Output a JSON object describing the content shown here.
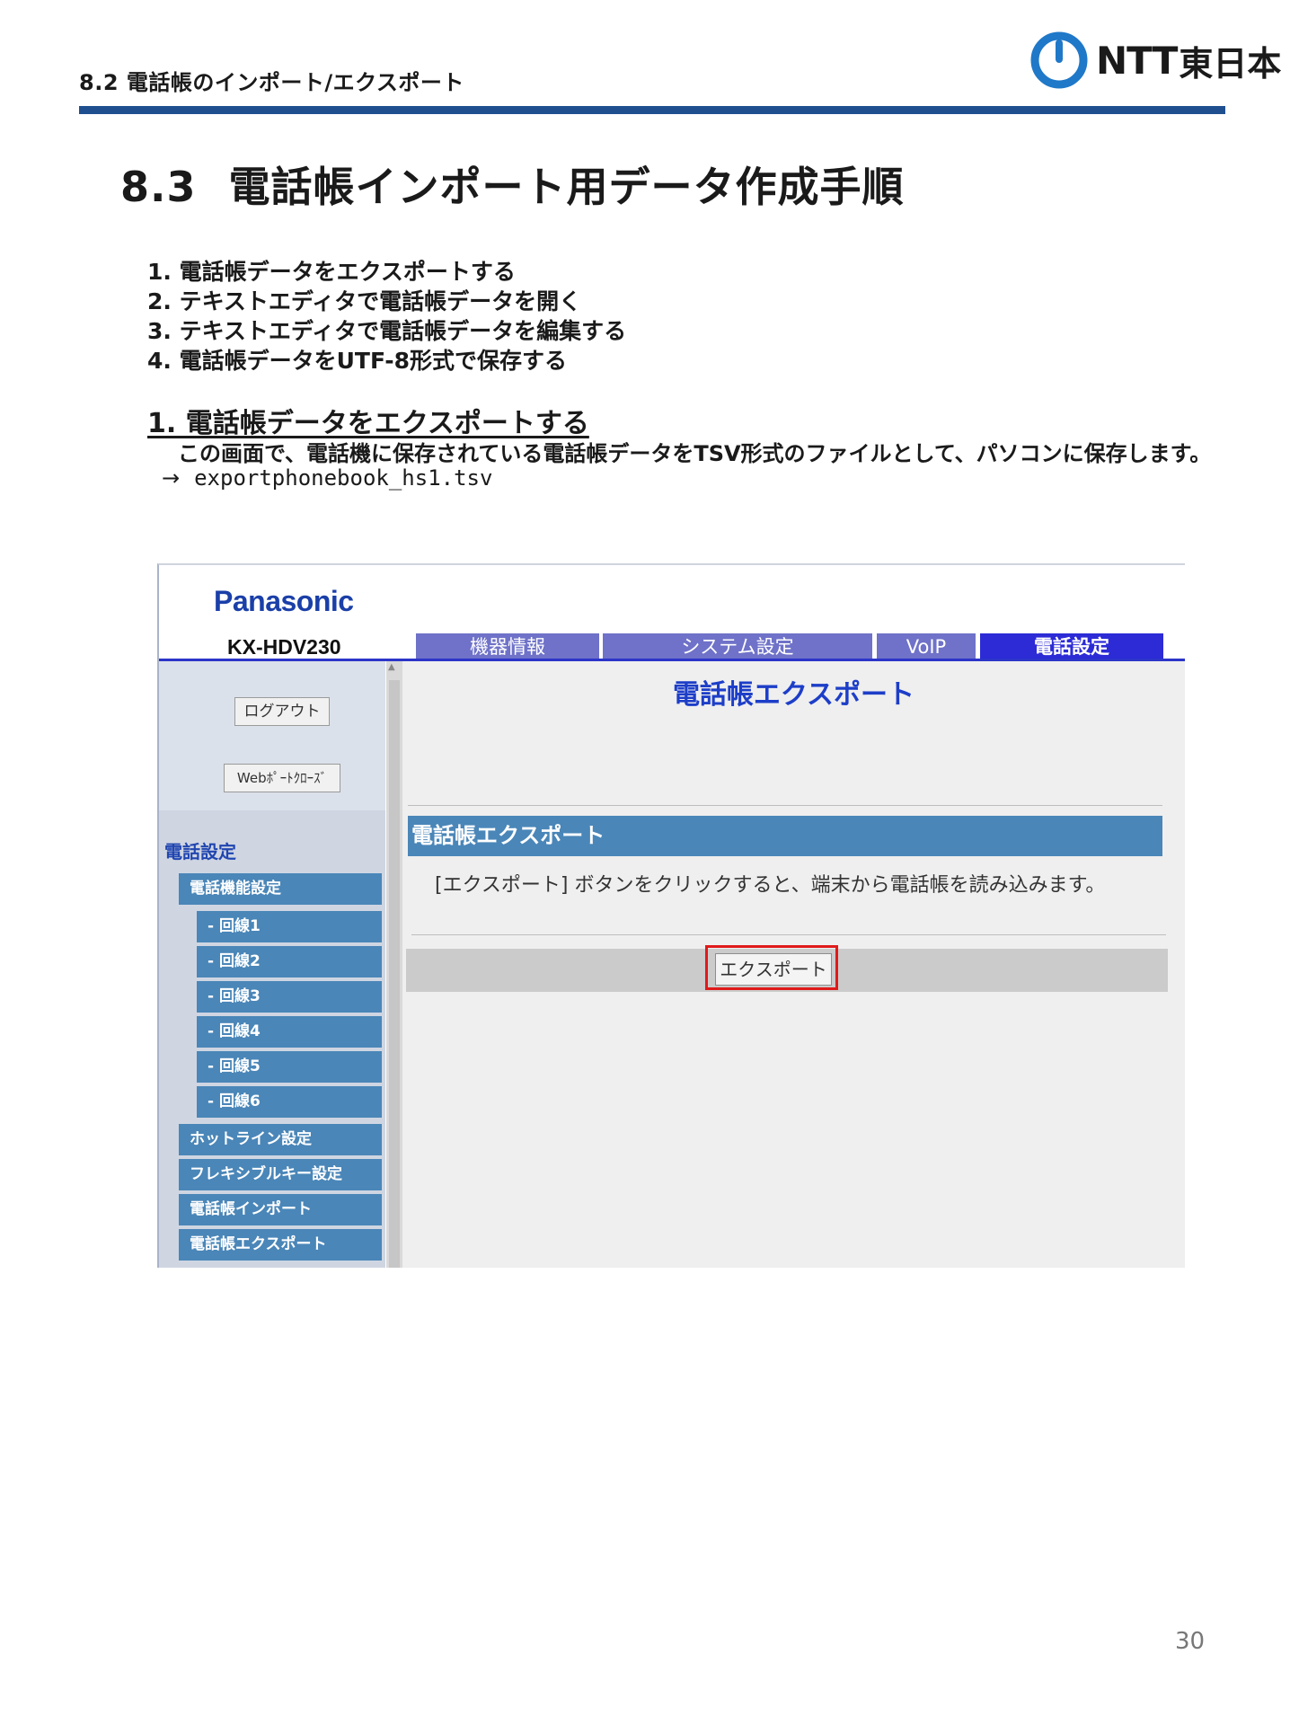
{
  "header": {
    "section": "8.2  電話帳のインポート/エクスポート",
    "logo_text": "NTT",
    "logo_suffix": "東日本",
    "brand_color": "#1f4f8f"
  },
  "title": {
    "number": "8.3",
    "text": "電話帳インポート用データ作成手順"
  },
  "steps": [
    "1. 電話帳データをエクスポートする",
    "2. テキストエディタで電話帳データを開く",
    "3. テキストエディタで電話帳データを編集する",
    "4. 電話帳データをUTF-8形式で保存する"
  ],
  "section1": {
    "heading": "1. 電話帳データをエクスポートする",
    "description": "この画面で、電話機に保存されている電話帳データをTSV形式のファイルとして、パソコンに保存します。",
    "arrow": "→",
    "filename": "exportphonebook_hs1.tsv"
  },
  "screenshot": {
    "brand": "Panasonic",
    "model": "KX-HDV230",
    "tabs": [
      "機器情報",
      "システム設定",
      "VoIP",
      "電話設定"
    ],
    "active_tab": "電話設定",
    "sidebar": {
      "logout": "ログアウト",
      "web_close": "Webﾎﾟｰﾄｸﾛｰｽﾞ",
      "heading": "電話設定",
      "items": [
        "電話機能設定",
        "- 回線1",
        "- 回線2",
        "- 回線3",
        "- 回線4",
        "- 回線5",
        "- 回線6",
        "ホットライン設定",
        "フレキシブルキー設定",
        "電話帳インポート",
        "電話帳エクスポート"
      ]
    },
    "main": {
      "title": "電話帳エクスポート",
      "section_title": "電話帳エクスポート",
      "description": "[エクスポート] ボタンをクリックすると、端末から電話帳を読み込みます。",
      "button": "エクスポート",
      "highlight_color": "#e01a1a"
    }
  },
  "page_number": "30"
}
